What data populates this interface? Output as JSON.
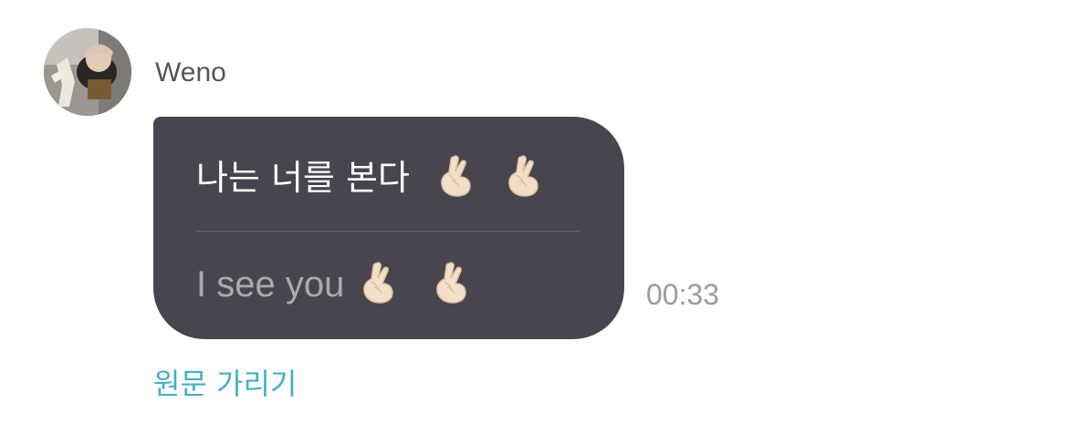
{
  "sender": {
    "name": "Weno"
  },
  "message": {
    "original_text": "나는 너를 본다",
    "translated_text": "I see you",
    "emoji_icon": "finger-heart-icon",
    "bubble_color": "#47464e",
    "timestamp": "00:33"
  },
  "actions": {
    "hide_original_label": "원문 가리기",
    "link_color": "#3fb2c4"
  }
}
